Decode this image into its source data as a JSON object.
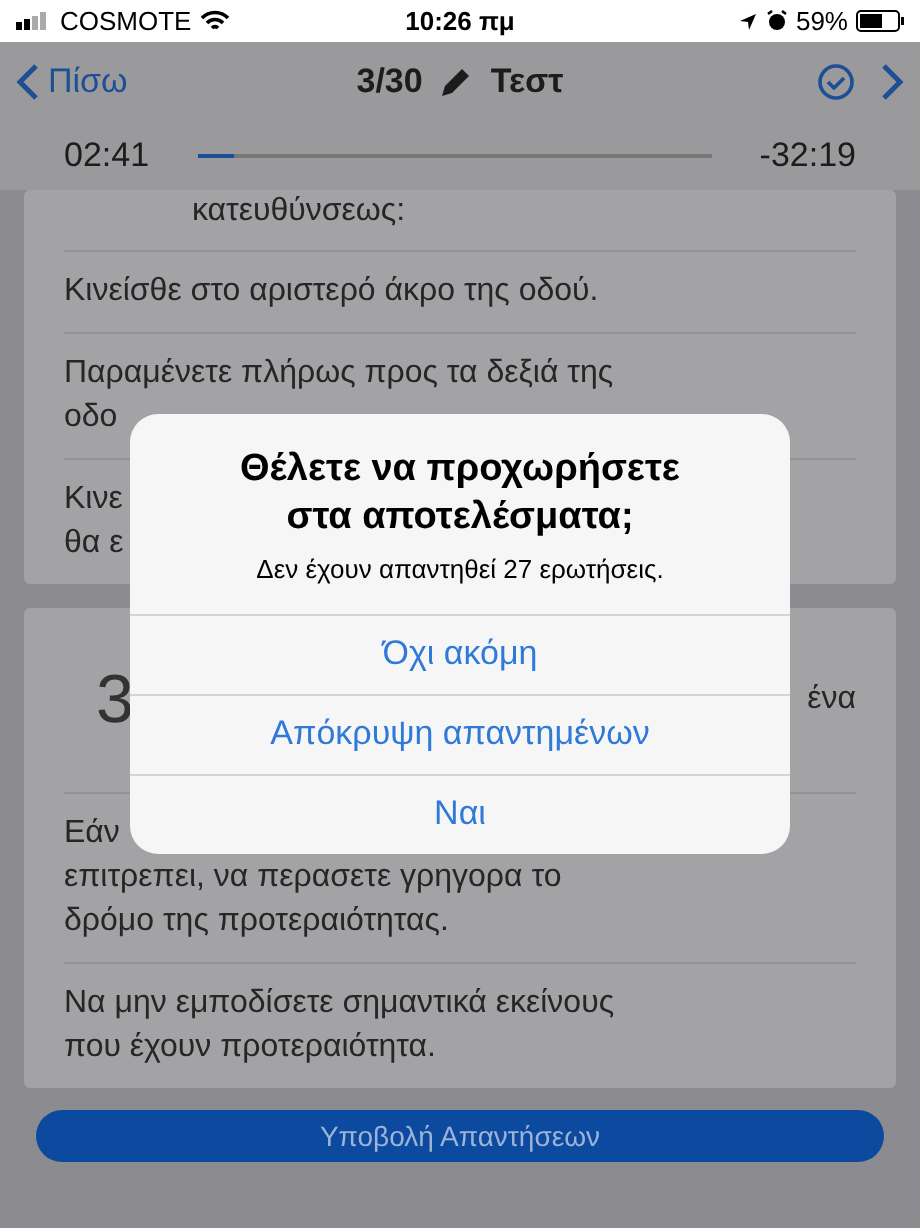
{
  "status_bar": {
    "carrier": "COSMOTE",
    "time": "10:26 πμ",
    "battery": "59%"
  },
  "nav": {
    "back": "Πίσω",
    "title": "3/30",
    "subtitle": "Τεστ"
  },
  "timer": {
    "elapsed": "02:41",
    "remaining": "-32:19",
    "level": 0.07
  },
  "questions": [
    {
      "lines": [
        "κατευθύνσεως:"
      ],
      "answers": [
        [
          "Κινείσθε στο αριστερό άκρο της οδού."
        ],
        [
          "Παραμένετε πλήρως προς τα δεξιά της",
          "οδο"
        ],
        [
          "Κινε",
          "θα ε"
        ]
      ]
    },
    {
      "number": "3",
      "lines": [
        "ένα"
      ],
      "answers": [
        [
          "Εάν",
          "επιτρεπει, να περασετε γρηγορα το",
          "δρόμο της προτεραιότητας."
        ],
        [
          "Να μην εμποδίσετε σημαντικά εκείνους",
          "που έχουν προτεραιότητα."
        ]
      ]
    }
  ],
  "submit": "Υποβολή Απαντήσεων",
  "dialog": {
    "title": "Θέλετε να προχωρήσετε στα αποτελέσματα;",
    "message": "Δεν έχουν απαντηθεί 27 ερωτήσεις.",
    "actions": [
      "Όχι ακόμη",
      "Απόκρυψη απαντημένων",
      "Ναι"
    ]
  }
}
